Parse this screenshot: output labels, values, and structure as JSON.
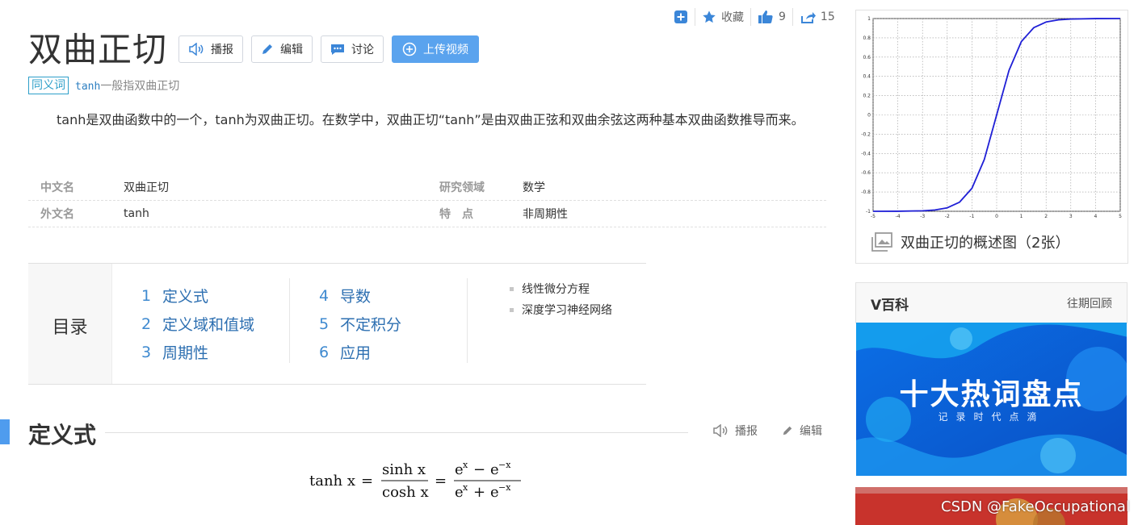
{
  "actions": {
    "favorite_label": "收藏",
    "like_count": "9",
    "share_count": "15"
  },
  "header": {
    "title": "双曲正切",
    "buttons": {
      "broadcast": "播报",
      "edit": "编辑",
      "discuss": "讨论",
      "upload_video": "上传视频"
    }
  },
  "synonym": {
    "tag": "同义词",
    "term": "tanh",
    "description": "一般指双曲正切"
  },
  "summary": "tanh是双曲函数中的一个，tanh为双曲正切。在数学中，双曲正切“tanh”是由双曲正弦和双曲余弦这两种基本双曲函数推导而来。",
  "info_table": [
    [
      {
        "key": "中文名",
        "value": "双曲正切"
      },
      {
        "key": "研究领域",
        "value": "数学"
      }
    ],
    [
      {
        "key": "外文名",
        "value": "tanh"
      },
      {
        "key": "特　点",
        "value": "非周期性"
      }
    ]
  ],
  "catalog": {
    "heading": "目录",
    "col1": [
      {
        "num": "1",
        "title": "定义式"
      },
      {
        "num": "2",
        "title": "定义域和值域"
      },
      {
        "num": "3",
        "title": "周期性"
      }
    ],
    "col2": [
      {
        "num": "4",
        "title": "导数"
      },
      {
        "num": "5",
        "title": "不定积分"
      },
      {
        "num": "6",
        "title": "应用"
      }
    ],
    "subitems": [
      "线性微分方程",
      "深度学习神经网络"
    ]
  },
  "section": {
    "title": "定义式",
    "broadcast": "播报",
    "edit": "编辑"
  },
  "formula": {
    "lhs": "tanh x",
    "num1": "sinh x",
    "den1": "cosh x",
    "exp_pos": "x",
    "exp_neg": "−x"
  },
  "sidebar": {
    "chart_caption": "双曲正切的概述图（2张）",
    "vbaike_title": "V百科",
    "vbaike_more": "往期回顾",
    "banner_title": "十大热词盘点",
    "banner_subtitle": "记录时代点滴",
    "watermark": "CSDN @FakeOccupational"
  },
  "chart_data": {
    "type": "line",
    "series": [
      {
        "x": [
          -5,
          -4,
          -3,
          -2.5,
          -2,
          -1.5,
          -1,
          -0.5,
          0,
          0.5,
          1,
          1.5,
          2,
          2.5,
          3,
          4,
          5
        ],
        "values": [
          -0.9999,
          -0.9993,
          -0.9951,
          -0.9866,
          -0.964,
          -0.9051,
          -0.7616,
          -0.4621,
          0,
          0.4621,
          0.7616,
          0.9051,
          0.964,
          0.9866,
          0.9951,
          0.9993,
          0.9999
        ]
      }
    ],
    "xlim": [
      -5,
      5
    ],
    "ylim": [
      -1,
      1
    ],
    "x_ticks": [
      "-5",
      "-4",
      "-3",
      "-2",
      "-1",
      "0",
      "1",
      "2",
      "3",
      "4",
      "5"
    ],
    "y_ticks": [
      "1",
      "0.8",
      "0.6",
      "0.4",
      "0.2",
      "0",
      "-0.2",
      "-0.4",
      "-0.6",
      "-0.8",
      "-1"
    ],
    "grid": true,
    "line_color": "#1f1fd6"
  }
}
